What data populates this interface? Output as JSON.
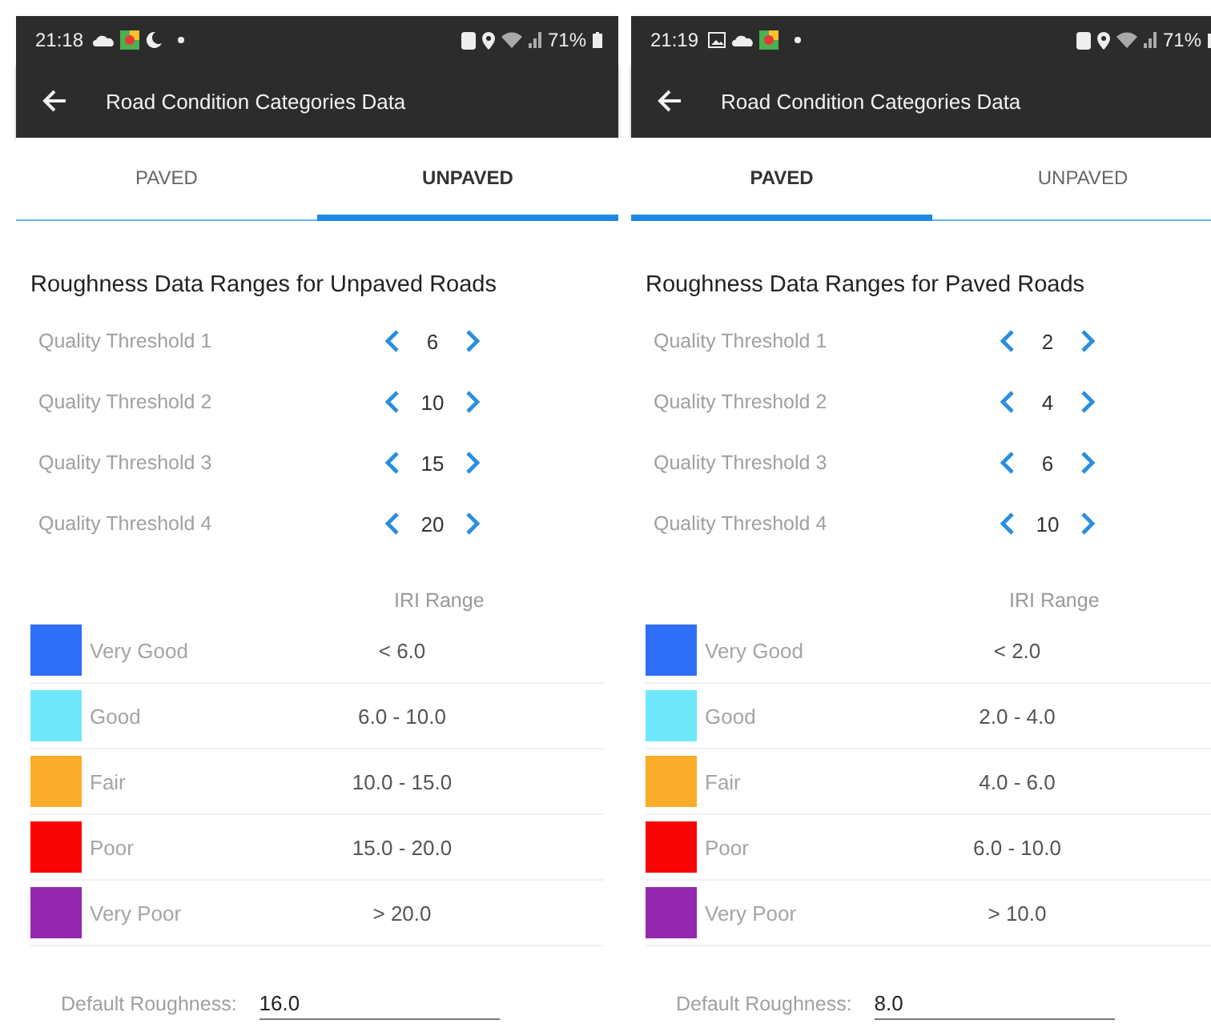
{
  "screens": [
    {
      "status_bar": {
        "time": "21:18",
        "battery": "71%",
        "icons": [
          {
            "kind": "cloud"
          },
          {
            "kind": "map"
          },
          {
            "kind": "moon"
          },
          {
            "kind": "dot"
          }
        ]
      },
      "app_bar": {
        "title": "Road Condition Categories Data"
      },
      "tabs": [
        {
          "label": "PAVED",
          "selected": false
        },
        {
          "label": "UNPAVED",
          "selected": true
        }
      ],
      "section_title": "Roughness Data Ranges for Unpaved Roads",
      "thresholds": [
        {
          "label": "Quality Threshold 1",
          "value": "6"
        },
        {
          "label": "Quality Threshold 2",
          "value": "10"
        },
        {
          "label": "Quality Threshold 3",
          "value": "15"
        },
        {
          "label": "Quality Threshold 4",
          "value": "20"
        }
      ],
      "iri_header": "IRI Range",
      "categories": [
        {
          "name": "Very Good",
          "color": "#2f6ff7",
          "range": "< 6.0"
        },
        {
          "name": "Good",
          "color": "#6fe8fb",
          "range": "6.0 - 10.0"
        },
        {
          "name": "Fair",
          "color": "#fbab2a",
          "range": "10.0 - 15.0"
        },
        {
          "name": "Poor",
          "color": "#f80505",
          "range": "15.0 - 20.0"
        },
        {
          "name": "Very Poor",
          "color": "#9427b0",
          "range": "> 20.0"
        }
      ],
      "default_roughness": {
        "label": "Default Roughness:",
        "value": "16.0"
      }
    },
    {
      "status_bar": {
        "time": "21:19",
        "battery": "71%",
        "icons": [
          {
            "kind": "image"
          },
          {
            "kind": "cloud"
          },
          {
            "kind": "map"
          },
          {
            "kind": "dot"
          }
        ]
      },
      "app_bar": {
        "title": "Road Condition Categories Data"
      },
      "tabs": [
        {
          "label": "PAVED",
          "selected": true
        },
        {
          "label": "UNPAVED",
          "selected": false
        }
      ],
      "section_title": "Roughness Data Ranges for Paved Roads",
      "thresholds": [
        {
          "label": "Quality Threshold 1",
          "value": "2"
        },
        {
          "label": "Quality Threshold 2",
          "value": "4"
        },
        {
          "label": "Quality Threshold 3",
          "value": "6"
        },
        {
          "label": "Quality Threshold 4",
          "value": "10"
        }
      ],
      "iri_header": "IRI Range",
      "categories": [
        {
          "name": "Very Good",
          "color": "#2f6ff7",
          "range": "< 2.0"
        },
        {
          "name": "Good",
          "color": "#6fe8fb",
          "range": "2.0 - 4.0"
        },
        {
          "name": "Fair",
          "color": "#fbab2a",
          "range": "4.0 - 6.0"
        },
        {
          "name": "Poor",
          "color": "#f80505",
          "range": "6.0 - 10.0"
        },
        {
          "name": "Very Poor",
          "color": "#9427b0",
          "range": "> 10.0"
        }
      ],
      "default_roughness": {
        "label": "Default Roughness:",
        "value": "8.0"
      }
    }
  ]
}
